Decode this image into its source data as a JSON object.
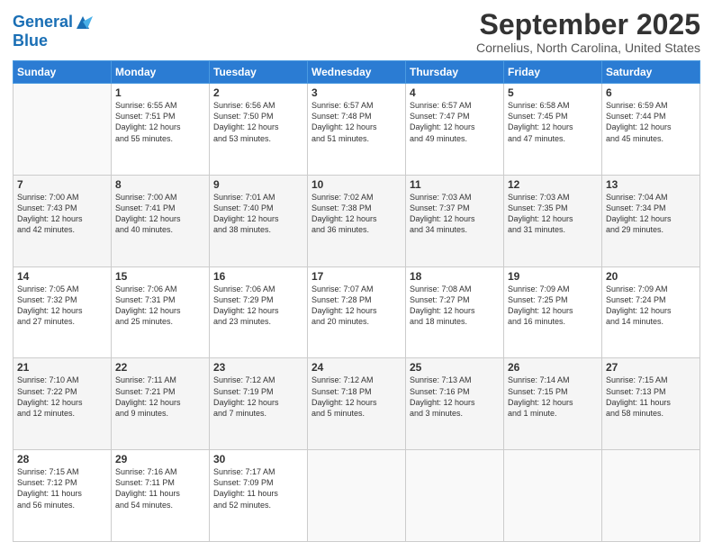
{
  "logo": {
    "line1": "General",
    "line2": "Blue"
  },
  "title": "September 2025",
  "location": "Cornelius, North Carolina, United States",
  "weekdays": [
    "Sunday",
    "Monday",
    "Tuesday",
    "Wednesday",
    "Thursday",
    "Friday",
    "Saturday"
  ],
  "weeks": [
    [
      {
        "day": "",
        "info": ""
      },
      {
        "day": "1",
        "info": "Sunrise: 6:55 AM\nSunset: 7:51 PM\nDaylight: 12 hours\nand 55 minutes."
      },
      {
        "day": "2",
        "info": "Sunrise: 6:56 AM\nSunset: 7:50 PM\nDaylight: 12 hours\nand 53 minutes."
      },
      {
        "day": "3",
        "info": "Sunrise: 6:57 AM\nSunset: 7:48 PM\nDaylight: 12 hours\nand 51 minutes."
      },
      {
        "day": "4",
        "info": "Sunrise: 6:57 AM\nSunset: 7:47 PM\nDaylight: 12 hours\nand 49 minutes."
      },
      {
        "day": "5",
        "info": "Sunrise: 6:58 AM\nSunset: 7:45 PM\nDaylight: 12 hours\nand 47 minutes."
      },
      {
        "day": "6",
        "info": "Sunrise: 6:59 AM\nSunset: 7:44 PM\nDaylight: 12 hours\nand 45 minutes."
      }
    ],
    [
      {
        "day": "7",
        "info": "Sunrise: 7:00 AM\nSunset: 7:43 PM\nDaylight: 12 hours\nand 42 minutes."
      },
      {
        "day": "8",
        "info": "Sunrise: 7:00 AM\nSunset: 7:41 PM\nDaylight: 12 hours\nand 40 minutes."
      },
      {
        "day": "9",
        "info": "Sunrise: 7:01 AM\nSunset: 7:40 PM\nDaylight: 12 hours\nand 38 minutes."
      },
      {
        "day": "10",
        "info": "Sunrise: 7:02 AM\nSunset: 7:38 PM\nDaylight: 12 hours\nand 36 minutes."
      },
      {
        "day": "11",
        "info": "Sunrise: 7:03 AM\nSunset: 7:37 PM\nDaylight: 12 hours\nand 34 minutes."
      },
      {
        "day": "12",
        "info": "Sunrise: 7:03 AM\nSunset: 7:35 PM\nDaylight: 12 hours\nand 31 minutes."
      },
      {
        "day": "13",
        "info": "Sunrise: 7:04 AM\nSunset: 7:34 PM\nDaylight: 12 hours\nand 29 minutes."
      }
    ],
    [
      {
        "day": "14",
        "info": "Sunrise: 7:05 AM\nSunset: 7:32 PM\nDaylight: 12 hours\nand 27 minutes."
      },
      {
        "day": "15",
        "info": "Sunrise: 7:06 AM\nSunset: 7:31 PM\nDaylight: 12 hours\nand 25 minutes."
      },
      {
        "day": "16",
        "info": "Sunrise: 7:06 AM\nSunset: 7:29 PM\nDaylight: 12 hours\nand 23 minutes."
      },
      {
        "day": "17",
        "info": "Sunrise: 7:07 AM\nSunset: 7:28 PM\nDaylight: 12 hours\nand 20 minutes."
      },
      {
        "day": "18",
        "info": "Sunrise: 7:08 AM\nSunset: 7:27 PM\nDaylight: 12 hours\nand 18 minutes."
      },
      {
        "day": "19",
        "info": "Sunrise: 7:09 AM\nSunset: 7:25 PM\nDaylight: 12 hours\nand 16 minutes."
      },
      {
        "day": "20",
        "info": "Sunrise: 7:09 AM\nSunset: 7:24 PM\nDaylight: 12 hours\nand 14 minutes."
      }
    ],
    [
      {
        "day": "21",
        "info": "Sunrise: 7:10 AM\nSunset: 7:22 PM\nDaylight: 12 hours\nand 12 minutes."
      },
      {
        "day": "22",
        "info": "Sunrise: 7:11 AM\nSunset: 7:21 PM\nDaylight: 12 hours\nand 9 minutes."
      },
      {
        "day": "23",
        "info": "Sunrise: 7:12 AM\nSunset: 7:19 PM\nDaylight: 12 hours\nand 7 minutes."
      },
      {
        "day": "24",
        "info": "Sunrise: 7:12 AM\nSunset: 7:18 PM\nDaylight: 12 hours\nand 5 minutes."
      },
      {
        "day": "25",
        "info": "Sunrise: 7:13 AM\nSunset: 7:16 PM\nDaylight: 12 hours\nand 3 minutes."
      },
      {
        "day": "26",
        "info": "Sunrise: 7:14 AM\nSunset: 7:15 PM\nDaylight: 12 hours\nand 1 minute."
      },
      {
        "day": "27",
        "info": "Sunrise: 7:15 AM\nSunset: 7:13 PM\nDaylight: 11 hours\nand 58 minutes."
      }
    ],
    [
      {
        "day": "28",
        "info": "Sunrise: 7:15 AM\nSunset: 7:12 PM\nDaylight: 11 hours\nand 56 minutes."
      },
      {
        "day": "29",
        "info": "Sunrise: 7:16 AM\nSunset: 7:11 PM\nDaylight: 11 hours\nand 54 minutes."
      },
      {
        "day": "30",
        "info": "Sunrise: 7:17 AM\nSunset: 7:09 PM\nDaylight: 11 hours\nand 52 minutes."
      },
      {
        "day": "",
        "info": ""
      },
      {
        "day": "",
        "info": ""
      },
      {
        "day": "",
        "info": ""
      },
      {
        "day": "",
        "info": ""
      }
    ]
  ]
}
